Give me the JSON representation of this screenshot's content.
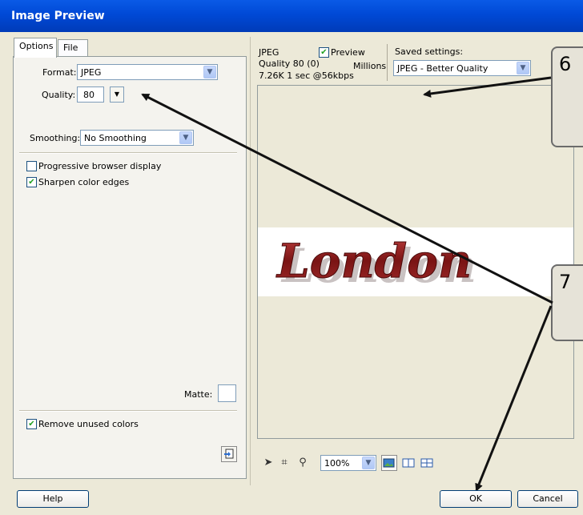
{
  "window": {
    "title": "Image Preview"
  },
  "tabs": [
    {
      "label": "Options"
    },
    {
      "label": "File"
    }
  ],
  "options": {
    "format_label": "Format:",
    "format_value": "JPEG",
    "quality_label": "Quality:",
    "quality_value": "80",
    "smoothing_label": "Smoothing:",
    "smoothing_value": "No Smoothing",
    "progressive_label": "Progressive browser display",
    "progressive_checked": false,
    "sharpen_label": "Sharpen color edges",
    "sharpen_checked": true,
    "matte_label": "Matte:",
    "remove_unused_label": "Remove unused colors",
    "remove_unused_checked": true
  },
  "preview_info": {
    "format": "JPEG",
    "quality": "Quality 80 (0)",
    "size": "7.26K  1 sec @56kbps",
    "preview_label": "Preview",
    "preview_checked": true,
    "colors": "Millions",
    "saved_settings_label": "Saved settings:",
    "saved_settings_value": "JPEG - Better Quality"
  },
  "preview_image": {
    "text": "London",
    "color": "#8b1a1a"
  },
  "toolbar": {
    "zoom_value": "100%"
  },
  "buttons": {
    "help": "Help",
    "ok": "OK",
    "cancel": "Cancel"
  },
  "callouts": [
    {
      "number": "6"
    },
    {
      "number": "7"
    }
  ],
  "colors": {
    "title_bar": "#0054e3",
    "dialog_bg": "#ece9d8",
    "check": "#21a121"
  }
}
